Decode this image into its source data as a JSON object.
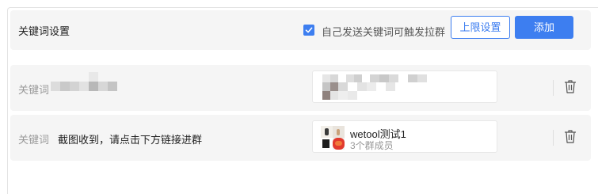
{
  "header": {
    "title": "关键词设置",
    "self_trigger_checked": true,
    "self_trigger_label": "自己发送关键词可触发拉群",
    "limit_button": "上限设置",
    "add_button": "添加"
  },
  "rules": [
    {
      "keyword_label": "关键词",
      "keyword": "",
      "group": {
        "name": "",
        "members": ""
      }
    },
    {
      "keyword_label": "关键词",
      "keyword": "截图收到，请点击下方链接进群",
      "group": {
        "name": "wetool测试1",
        "members": "3个群成员"
      }
    }
  ],
  "colors": {
    "accent": "#3d7ef0",
    "row_bg": "#f5f5f5",
    "muted": "#999999"
  }
}
